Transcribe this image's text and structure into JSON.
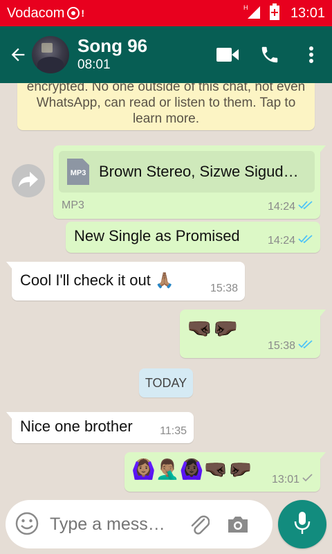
{
  "status_bar": {
    "carrier": "Vodacom",
    "network_type": "H",
    "time": "13:01"
  },
  "app_bar": {
    "contact_name": "Song 96",
    "subtitle": "08:01",
    "icons": [
      "back-arrow-icon",
      "video-call-icon",
      "voice-call-icon",
      "more-options-icon"
    ]
  },
  "encryption_notice": {
    "line1": "encrypted. No one outside of this chat, not even",
    "line2": "WhatsApp, can read or listen to them. Tap to",
    "line3": "learn more."
  },
  "messages": [
    {
      "type": "file",
      "direction": "out",
      "icon_label": "MP3",
      "file_name": "Brown Stereo, Sizwe Sigud…",
      "file_type": "MP3",
      "time": "14:24",
      "status": "read"
    },
    {
      "type": "text",
      "direction": "out",
      "text": "New Single as Promised",
      "time": "14:24",
      "status": "read"
    },
    {
      "type": "text",
      "direction": "in",
      "text": "Cool I'll check it out 🙏🏽",
      "time": "15:38"
    },
    {
      "type": "emoji",
      "direction": "out",
      "text": "🤜🏿🤛🏿",
      "time": "15:38",
      "status": "read"
    },
    {
      "type": "date",
      "text": "TODAY"
    },
    {
      "type": "text",
      "direction": "in",
      "text": "Nice one brother",
      "time": "11:35"
    },
    {
      "type": "emoji",
      "direction": "out",
      "text": "🙆🏽‍♀️🤦🏽‍♂️🙆🏿‍♀️🤜🏿🤛🏿",
      "time": "13:01",
      "status": "delivered"
    }
  ],
  "composer": {
    "placeholder": "Type a mess…"
  },
  "colors": {
    "status_bar": "#e8001e",
    "app_bar": "#075e54",
    "outgoing_bubble": "#dcf8c6",
    "incoming_bubble": "#ffffff",
    "read_ticks": "#4fc3f7",
    "delivered_ticks": "#9e9e9e",
    "mic_button": "#128c7e"
  }
}
